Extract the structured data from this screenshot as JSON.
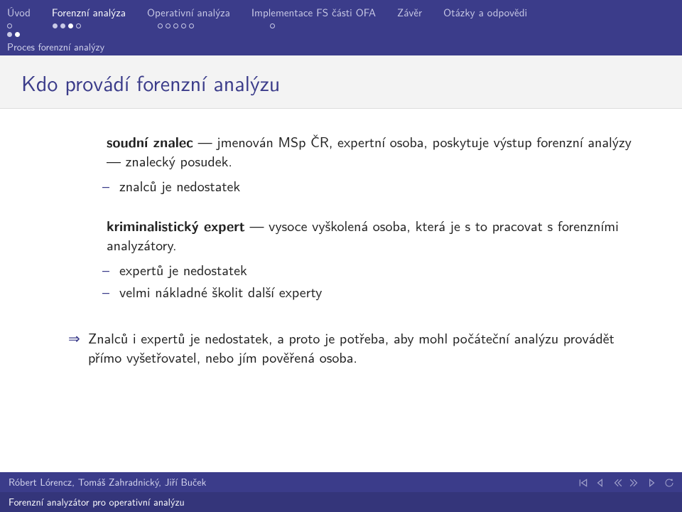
{
  "navbar": {
    "items": [
      {
        "label": "Úvod",
        "active": false
      },
      {
        "label": "Forenzní analýza",
        "active": true
      },
      {
        "label": "Operativní analýza",
        "active": false
      },
      {
        "label": "Implementace FS části OFA",
        "active": false
      },
      {
        "label": "Závěr",
        "active": false
      },
      {
        "label": "Otázky a odpovědi",
        "active": false
      }
    ],
    "progress": {
      "uvod": {
        "dots": 1,
        "filled": 0,
        "active": -1
      },
      "forenzni": {
        "dots": 4,
        "filled": 2,
        "active": 2
      },
      "operativni": {
        "dots": 5,
        "filled": 0,
        "active": -1
      },
      "implementace": {
        "dots": 1,
        "filled": 0,
        "active": -1
      }
    },
    "subsection": "Proces forenzní analýzy",
    "subdots": {
      "dots": 2,
      "filled": 1,
      "active": 1
    }
  },
  "title": "Kdo provádí forenzní analýzu",
  "body": {
    "block1_strong": "soudní znalec",
    "block1_text": " — jmenován MSp ČR, expertní osoba, poskytuje výstup forenzní analýzy — znalecký posudek.",
    "block1_sub1": "znalců je nedostatek",
    "block2_strong": "kriminalistický expert",
    "block2_text": " — vysoce vyškolená osoba, která je s to pracovat s forenzními analyzátory.",
    "block2_sub1": "expertů je nedostatek",
    "block2_sub2": "velmi nákladné školit další experty",
    "implies": "Znalců i expertů je nedostatek, a proto je potřeba, aby mohl počáteční analýzu provádět přímo vyšetřovatel, nebo jím pověřená osoba.",
    "arrow": "⇒"
  },
  "footer": {
    "authors": "Róbert Lórencz, Tomáš Zahradnický, Jiří Buček",
    "presentation": "Forenzní analyzátor pro operativní analýzu"
  }
}
